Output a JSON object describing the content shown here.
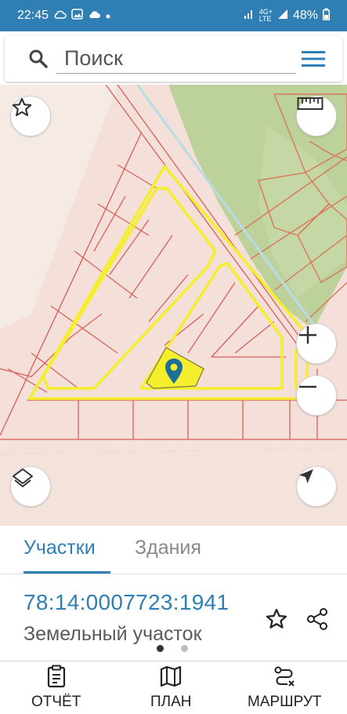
{
  "status_bar": {
    "time": "22:45",
    "network": "4G+",
    "network_sub": "LTE",
    "battery": "48%"
  },
  "search": {
    "placeholder": "Поиск"
  },
  "icons": {
    "favorite": "star-outline-icon",
    "ruler": "ruler-icon",
    "zoom_in": "plus-icon",
    "zoom_out": "minus-icon",
    "layers": "layers-icon",
    "location": "navigation-arrow-icon",
    "marker": "map-pin-icon",
    "share": "share-icon"
  },
  "colors": {
    "accent": "#2f7fb4",
    "highlight": "#f5ee2c",
    "map_parcel_fill": "#f2d6cc",
    "map_parcel_line": "#d5645f",
    "map_green": "#b8cf92"
  },
  "tabs": [
    {
      "label": "Участки",
      "active": true
    },
    {
      "label": "Здания",
      "active": false
    }
  ],
  "parcel": {
    "cadastral_number": "78:14:0007723:1941",
    "type": "Земельный участок"
  },
  "pager": {
    "pages": 2,
    "current": 1
  },
  "bottom_nav": [
    {
      "label": "ОТЧЁТ",
      "icon": "clipboard-icon"
    },
    {
      "label": "ПЛАН",
      "icon": "map-icon"
    },
    {
      "label": "МАРШРУТ",
      "icon": "route-icon"
    }
  ]
}
